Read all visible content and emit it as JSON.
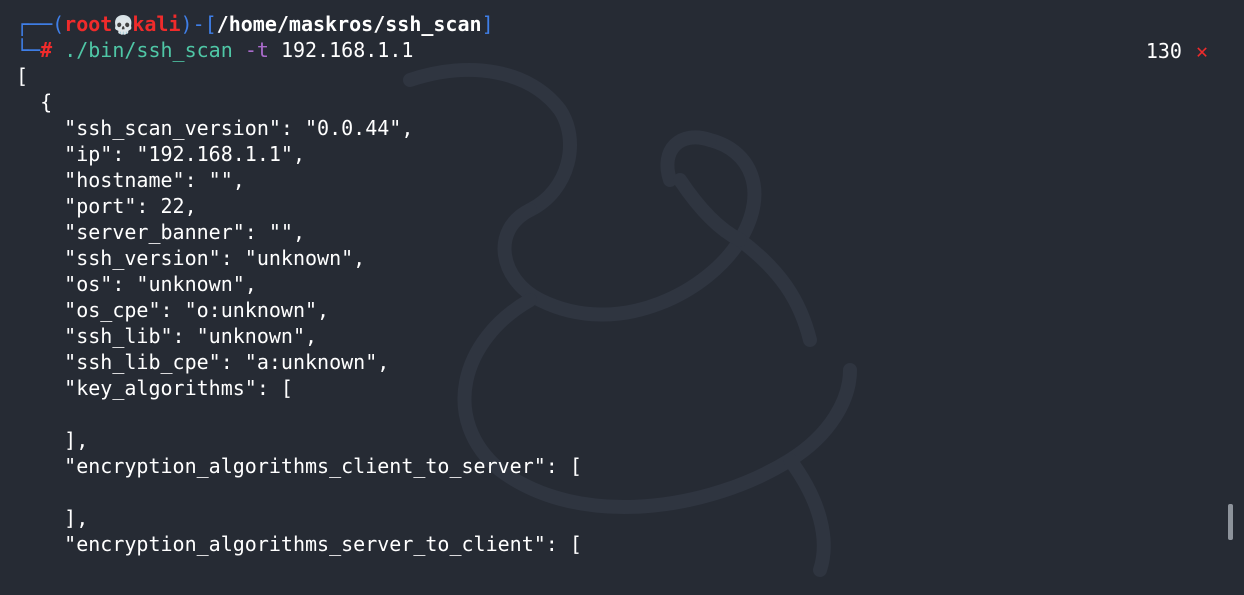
{
  "prompt": {
    "corner_top": "┌──",
    "open_paren": "(",
    "user": "root",
    "skull": "💀",
    "host": "kali",
    "close_paren": ")",
    "dash": "-",
    "open_bracket": "[",
    "path": "/home/maskros/ssh_scan",
    "close_bracket": "]",
    "corner_bottom": "└─",
    "hash": "#",
    "command": "./bin/ssh_scan",
    "option": "-t",
    "argument": "192.168.1.1"
  },
  "status": {
    "exit_code": "130",
    "failure_mark": "✕"
  },
  "output": [
    "[",
    "  {",
    "    \"ssh_scan_version\": \"0.0.44\",",
    "    \"ip\": \"192.168.1.1\",",
    "    \"hostname\": \"\",",
    "    \"port\": 22,",
    "    \"server_banner\": \"\",",
    "    \"ssh_version\": \"unknown\",",
    "    \"os\": \"unknown\",",
    "    \"os_cpe\": \"o:unknown\",",
    "    \"ssh_lib\": \"unknown\",",
    "    \"ssh_lib_cpe\": \"a:unknown\",",
    "    \"key_algorithms\": [",
    "",
    "    ],",
    "    \"encryption_algorithms_client_to_server\": [",
    "",
    "    ],",
    "    \"encryption_algorithms_server_to_client\": ["
  ],
  "colors": {
    "background": "#262b34",
    "prompt_frame": "#3f7fe8",
    "prompt_user": "#ef2b2b",
    "command": "#4fc7a6",
    "option": "#a96bcb",
    "text": "#ffffff"
  }
}
